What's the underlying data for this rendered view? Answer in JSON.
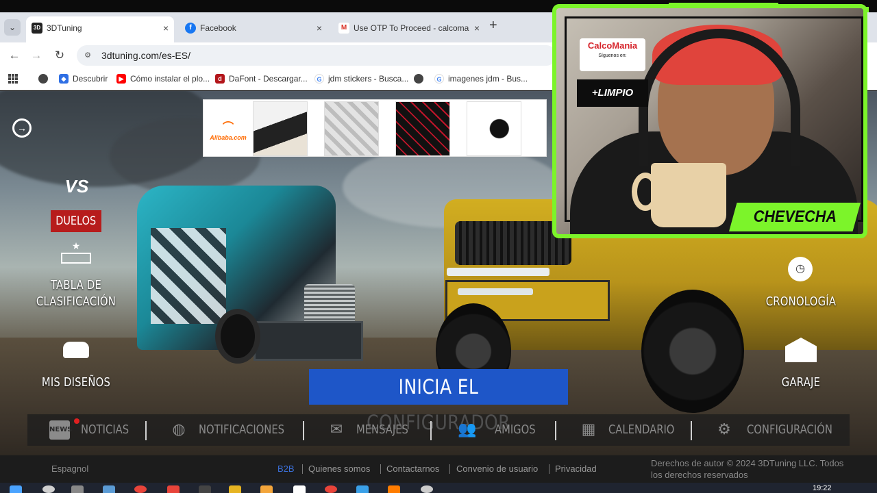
{
  "browser": {
    "tabs": [
      {
        "title": "3DTuning",
        "favicon": "3dt-icon",
        "active": true
      },
      {
        "title": "Facebook",
        "favicon": "facebook-icon",
        "active": false
      },
      {
        "title": "Use OTP To Proceed - calcoma",
        "favicon": "gmail-icon",
        "active": false
      }
    ],
    "new_tab": "+",
    "url": "3dtuning.com/es-ES/",
    "bookmarks": [
      {
        "label": "Descubrir",
        "icon": "descubrir-icon"
      },
      {
        "label": "Cómo instalar el plo...",
        "icon": "youtube-icon"
      },
      {
        "label": "DaFont - Descargar...",
        "icon": "dafont-icon"
      },
      {
        "label": "jdm stickers - Busca...",
        "icon": "google-icon"
      },
      {
        "label": "imagenes jdm - Bus...",
        "icon": "google-icon"
      }
    ]
  },
  "ad": {
    "logo": "Alibaba.com"
  },
  "sidenav": {
    "duels": "DUELOS",
    "leaderboard_line1": "TABLA DE",
    "leaderboard_line2": "CLASIFICACIÓN",
    "my_designs": "MIS DISEÑOS",
    "timeline": "CRONOLOGÍA",
    "garage": "GARAJE"
  },
  "cta": "INICIA EL CONFIGURADOR",
  "bottomnav": [
    {
      "label": "NOTICIAS",
      "icon": "news-icon"
    },
    {
      "label": "NOTIFICACIONES",
      "icon": "globe-icon"
    },
    {
      "label": "MENSAJES",
      "icon": "mail-icon"
    },
    {
      "label": "AMIGOS",
      "icon": "friends-icon"
    },
    {
      "label": "CALENDARIO",
      "icon": "calendar-icon"
    },
    {
      "label": "CONFIGURACIÓN",
      "icon": "gear-icon"
    }
  ],
  "footer": {
    "language": "Espagnol",
    "links": [
      "B2B",
      "Quienes somos",
      "Contactarnos",
      "Convenio de usuario",
      "Privacidad"
    ],
    "copyright_line1": "Derechos de autor © 2024 3DTuning LLC. Todos",
    "copyright_line2": "los derechos reservados"
  },
  "webcam": {
    "logo_top": "CalcoMania",
    "logo_sub": "Síguenos en:",
    "brand": "+LIMPIO",
    "name": "CHEVECHA"
  },
  "taskbar": {
    "time": "19:22"
  },
  "colors": {
    "cta": "#1e56c8",
    "duel_badge": "#b71c1c",
    "webcam_frame": "#7cf42a",
    "b2b_link": "#3b6fd8"
  }
}
